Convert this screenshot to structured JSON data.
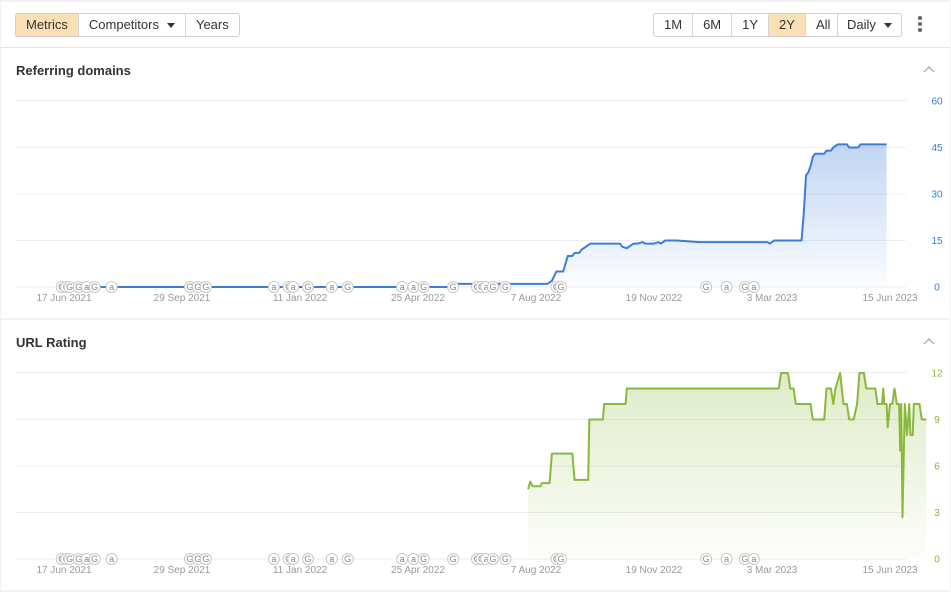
{
  "toolbar": {
    "view_tabs": [
      {
        "label": "Metrics",
        "active": true
      },
      {
        "label": "Competitors",
        "dropdown": true
      },
      {
        "label": "Years"
      }
    ],
    "ranges": [
      {
        "label": "1M"
      },
      {
        "label": "6M"
      },
      {
        "label": "1Y"
      },
      {
        "label": "2Y",
        "active": true
      },
      {
        "label": "All"
      }
    ],
    "interval": "Daily",
    "more_icon": "kebab-vertical-icon"
  },
  "colors": {
    "active_tab_bg": "#fbe0b6",
    "referring_domains_line": "#3b7dd8",
    "url_rating_line": "#8ab83a"
  },
  "chart_data": [
    {
      "id": "referring-domains",
      "type": "area",
      "title": "Referring domains",
      "x_unit": "days since 17 Jun 2021",
      "x_tick_labels": [
        "17 Jun 2021",
        "29 Sep 2021",
        "11 Jan 2022",
        "25 Apr 2022",
        "7 Aug 2022",
        "19 Nov 2022",
        "3 Mar 2023",
        "15 Jun 2023"
      ],
      "x_tick_days": [
        0,
        104,
        208,
        312,
        416,
        520,
        624,
        728
      ],
      "y_ticks": [
        0,
        15,
        30,
        45,
        60
      ],
      "ylim": [
        0,
        60
      ],
      "y_axis_side": "right",
      "grid": true,
      "color": "#3b7dd8",
      "points": [
        [
          -3,
          0
        ],
        [
          346,
          0
        ],
        [
          346,
          1
        ],
        [
          426,
          1
        ],
        [
          430,
          2
        ],
        [
          434,
          5
        ],
        [
          440,
          5
        ],
        [
          444,
          10
        ],
        [
          448,
          10
        ],
        [
          450,
          11
        ],
        [
          454,
          11
        ],
        [
          456,
          12
        ],
        [
          460,
          13
        ],
        [
          464,
          14
        ],
        [
          470,
          14
        ],
        [
          490,
          14
        ],
        [
          492,
          13
        ],
        [
          496,
          12.5
        ],
        [
          498,
          13
        ],
        [
          502,
          14
        ],
        [
          506,
          14
        ],
        [
          510,
          14.5
        ],
        [
          512,
          14
        ],
        [
          520,
          14
        ],
        [
          524,
          14.5
        ],
        [
          526,
          14
        ],
        [
          530,
          15
        ],
        [
          540,
          15
        ],
        [
          560,
          14.5
        ],
        [
          620,
          14.5
        ],
        [
          622,
          14
        ],
        [
          626,
          15
        ],
        [
          650,
          15
        ],
        [
          652,
          24
        ],
        [
          654,
          36
        ],
        [
          656,
          37
        ],
        [
          658,
          39
        ],
        [
          660,
          42
        ],
        [
          662,
          43
        ],
        [
          666,
          43
        ],
        [
          670,
          43
        ],
        [
          672,
          44
        ],
        [
          676,
          44
        ],
        [
          678,
          45
        ],
        [
          682,
          46
        ],
        [
          690,
          46
        ],
        [
          692,
          45
        ],
        [
          700,
          45
        ],
        [
          702,
          46
        ],
        [
          725,
          46
        ]
      ],
      "annotations": [
        "G",
        "G",
        "G",
        "G",
        "a",
        "G",
        "a",
        "G",
        "G",
        "G",
        "a",
        "G",
        "a",
        "G",
        "a",
        "G",
        "a",
        "a",
        "G",
        "G",
        "G",
        "G",
        "a",
        "G",
        "G",
        "G",
        "G",
        "G",
        "a",
        "G",
        "a"
      ]
    },
    {
      "id": "url-rating",
      "type": "area",
      "title": "URL Rating",
      "x_unit": "days since 17 Jun 2021",
      "x_tick_labels": [
        "17 Jun 2021",
        "29 Sep 2021",
        "11 Jan 2022",
        "25 Apr 2022",
        "7 Aug 2022",
        "19 Nov 2022",
        "3 Mar 2023",
        "15 Jun 2023"
      ],
      "x_tick_days": [
        0,
        104,
        208,
        312,
        416,
        520,
        624,
        728
      ],
      "y_ticks": [
        0,
        3,
        6,
        9,
        12
      ],
      "ylim": [
        0,
        12
      ],
      "y_axis_side": "right",
      "grid": true,
      "color": "#8ab83a",
      "points": [
        [
          409,
          4.5
        ],
        [
          411,
          5
        ],
        [
          413,
          4.7
        ],
        [
          420,
          4.7
        ],
        [
          421,
          4.9
        ],
        [
          428,
          4.9
        ],
        [
          430,
          6.8
        ],
        [
          448,
          6.8
        ],
        [
          450,
          5.1
        ],
        [
          462,
          5.1
        ],
        [
          463,
          9
        ],
        [
          475,
          9
        ],
        [
          476,
          10
        ],
        [
          495,
          10
        ],
        [
          496,
          11
        ],
        [
          630,
          11
        ],
        [
          632,
          12
        ],
        [
          638,
          12
        ],
        [
          640,
          11
        ],
        [
          643,
          11
        ],
        [
          645,
          10
        ],
        [
          658,
          10
        ],
        [
          660,
          9
        ],
        [
          670,
          9
        ],
        [
          672,
          11
        ],
        [
          676,
          11
        ],
        [
          678,
          10
        ],
        [
          680,
          11
        ],
        [
          684,
          12
        ],
        [
          687,
          10
        ],
        [
          690,
          10
        ],
        [
          692,
          9
        ],
        [
          696,
          9
        ],
        [
          699,
          10
        ],
        [
          701,
          12
        ],
        [
          705,
          12
        ],
        [
          707,
          11
        ],
        [
          715,
          11
        ],
        [
          717,
          10
        ],
        [
          721,
          10
        ],
        [
          722,
          11
        ],
        [
          723,
          10
        ],
        [
          725,
          10
        ],
        [
          726,
          8.5
        ],
        [
          728,
          10
        ],
        [
          730,
          10
        ],
        [
          732,
          11
        ],
        [
          734,
          10
        ],
        [
          736,
          10
        ],
        [
          737,
          7
        ],
        [
          738,
          10
        ],
        [
          739,
          2.7
        ],
        [
          741,
          10
        ],
        [
          743,
          8
        ],
        [
          745,
          10
        ],
        [
          746,
          8
        ],
        [
          748,
          8
        ],
        [
          749,
          10
        ],
        [
          754,
          10
        ],
        [
          756,
          9
        ],
        [
          760,
          9
        ]
      ],
      "annotations": [
        "G",
        "G",
        "G",
        "G",
        "a",
        "G",
        "a",
        "G",
        "G",
        "G",
        "a",
        "G",
        "a",
        "G",
        "a",
        "G",
        "a",
        "a",
        "G",
        "G",
        "G",
        "G",
        "a",
        "G",
        "G",
        "G",
        "G",
        "G",
        "a",
        "G",
        "a"
      ]
    }
  ],
  "sections": [
    {
      "title": "Referring domains",
      "collapse_icon": "chevron-up-icon"
    },
    {
      "title": "URL Rating",
      "collapse_icon": "chevron-up-icon"
    }
  ]
}
